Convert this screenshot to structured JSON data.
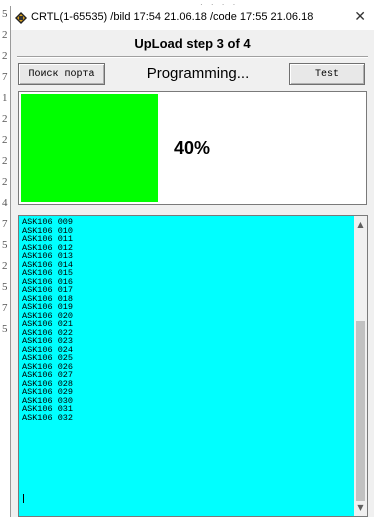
{
  "background": {
    "edge_chars": [
      "5",
      "2",
      "2",
      "7",
      "1",
      "2",
      "2",
      "2",
      "2",
      "4",
      "7",
      "5",
      "2",
      "5",
      "7",
      "5"
    ]
  },
  "window": {
    "title": "CRTL(1-65535) /bild 17:54 21.06.18 /code 17:55 21.06.18",
    "close_glyph": "✕",
    "step_header": "UpLoad step 3 of 4"
  },
  "toolbar": {
    "find_port_label": "Поиск порта",
    "status_text": "Programming...",
    "test_label": "Test"
  },
  "progress": {
    "value": 0.4,
    "label": "40%",
    "fill_color": "#00ff00"
  },
  "log": {
    "background_color": "#00ffff",
    "lines": [
      "ASK106 009",
      "ASK106 010",
      "ASK106 011",
      "ASK106 012",
      "ASK106 013",
      "ASK106 014",
      "ASK106 015",
      "ASK106 016",
      "ASK106 017",
      "ASK106 018",
      "ASK106 019",
      "ASK106 020",
      "ASK106 021",
      "ASK106 022",
      "ASK106 023",
      "ASK106 024",
      "ASK106 025",
      "ASK106 026",
      "ASK106 027",
      "ASK106 028",
      "ASK106 029",
      "ASK106 030",
      "ASK106 031",
      "ASK106 032"
    ],
    "scroll_up_glyph": "▲",
    "scroll_down_glyph": "▼"
  }
}
